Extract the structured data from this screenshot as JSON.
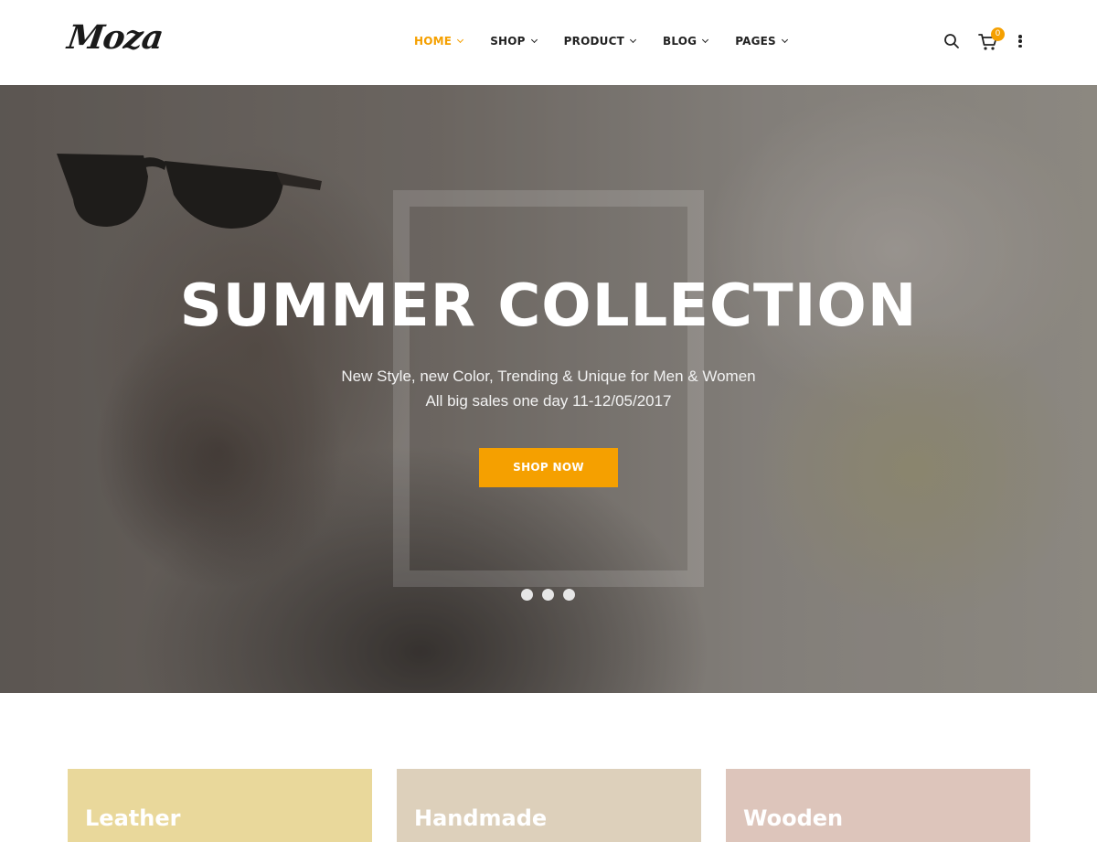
{
  "brand": {
    "logo_text": "Moza",
    "accent": "#f5a000"
  },
  "nav": {
    "items": [
      {
        "label": "HOME",
        "active": true
      },
      {
        "label": "SHOP",
        "active": false
      },
      {
        "label": "PRODUCT",
        "active": false
      },
      {
        "label": "BLOG",
        "active": false
      },
      {
        "label": "PAGES",
        "active": false
      }
    ]
  },
  "tools": {
    "search_icon": "search-icon",
    "cart_icon": "cart-icon",
    "cart_count": "0",
    "more_icon": "more-vertical-icon"
  },
  "hero": {
    "title": "SUMMER COLLECTION",
    "subtitle_line1": "New Style, new Color, Trending & Unique for Men & Women",
    "subtitle_line2": "All big sales one day 11-12/05/2017",
    "button_label": "SHOP NOW",
    "slides": 3
  },
  "categories": [
    {
      "title": "Leather",
      "color": "#e9d89b"
    },
    {
      "title": "Handmade",
      "color": "#ddd0bb"
    },
    {
      "title": "Wooden",
      "color": "#ddc5bb"
    }
  ]
}
